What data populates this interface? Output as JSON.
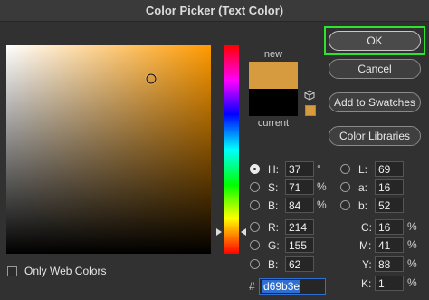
{
  "window": {
    "title": "Color Picker (Text Color)"
  },
  "field": {
    "base_hue_color": "#ff9a00",
    "cursor_saturation_pct": 71,
    "cursor_brightness_pct": 84
  },
  "hue_strip": {
    "hue_deg": 37
  },
  "preview": {
    "new_label": "new",
    "current_label": "current",
    "new_color": "#d69b3e",
    "current_color": "#000000"
  },
  "buttons": {
    "ok": "OK",
    "cancel": "Cancel",
    "add_to_swatches": "Add to Swatches",
    "color_libraries": "Color Libraries"
  },
  "hsb": {
    "h": {
      "label": "H:",
      "value": "37",
      "unit": "°"
    },
    "s": {
      "label": "S:",
      "value": "71",
      "unit": "%"
    },
    "b": {
      "label": "B:",
      "value": "84",
      "unit": "%"
    }
  },
  "rgb": {
    "r": {
      "label": "R:",
      "value": "214"
    },
    "g": {
      "label": "G:",
      "value": "155"
    },
    "b": {
      "label": "B:",
      "value": "62"
    }
  },
  "lab": {
    "l": {
      "label": "L:",
      "value": "69"
    },
    "a": {
      "label": "a:",
      "value": "16"
    },
    "b": {
      "label": "b:",
      "value": "52"
    }
  },
  "cmyk": {
    "c": {
      "label": "C:",
      "value": "16",
      "unit": "%"
    },
    "m": {
      "label": "M:",
      "value": "41",
      "unit": "%"
    },
    "y": {
      "label": "Y:",
      "value": "88",
      "unit": "%"
    },
    "k": {
      "label": "K:",
      "value": "1",
      "unit": "%"
    }
  },
  "hex": {
    "label": "#",
    "value": "d69b3e"
  },
  "web_colors": {
    "label": "Only Web Colors",
    "checked": false
  },
  "selected_channel": "H"
}
